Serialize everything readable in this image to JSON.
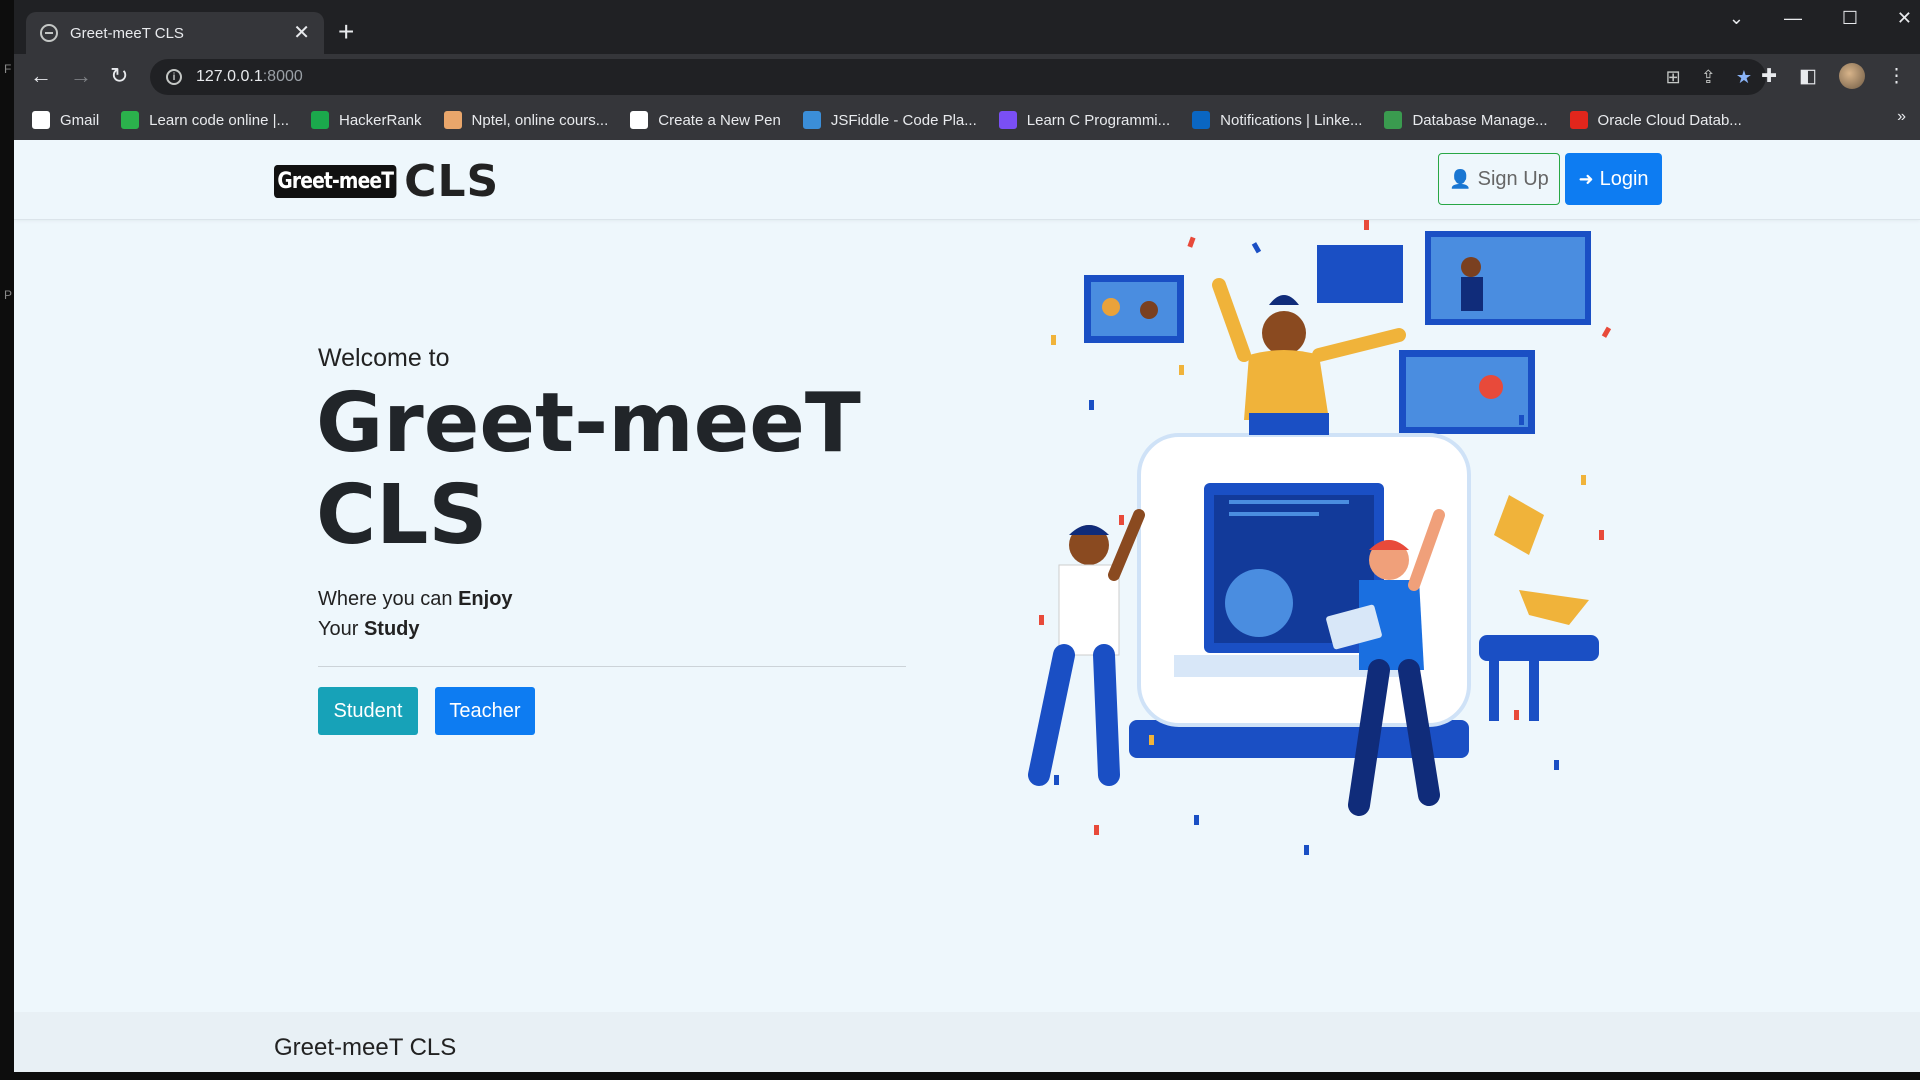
{
  "browser": {
    "tab_title": "Greet-meeT CLS",
    "tab_close": "✕",
    "new_tab": "+",
    "url_host": "127.0.0.1",
    "url_port": ":8000",
    "bookmarks": [
      {
        "label": "Gmail",
        "icon": "google-icon",
        "color": "#ffffff"
      },
      {
        "label": "Learn code online |...",
        "icon": "learncode-icon",
        "color": "#2bb24c"
      },
      {
        "label": "HackerRank",
        "icon": "hackerrank-icon",
        "color": "#1ba94c"
      },
      {
        "label": "Nptel, online cours...",
        "icon": "nptel-icon",
        "color": "#e9a66b"
      },
      {
        "label": "Create a New Pen",
        "icon": "codepen-icon",
        "color": "#ffffff"
      },
      {
        "label": "JSFiddle - Code Pla...",
        "icon": "jsfiddle-icon",
        "color": "#3b8ed8"
      },
      {
        "label": "Learn C Programmi...",
        "icon": "programiz-icon",
        "color": "#7a4ff5"
      },
      {
        "label": "Notifications | Linke...",
        "icon": "linkedin-icon",
        "color": "#0a66c2"
      },
      {
        "label": "Database Manage...",
        "icon": "database-icon",
        "color": "#3a9b4f"
      },
      {
        "label": "Oracle Cloud Datab...",
        "icon": "oracle-icon",
        "color": "#e1261c"
      }
    ],
    "bookmarks_more": "»"
  },
  "navbar": {
    "brand_box": "Greet-meeT",
    "brand_cls": "CLS",
    "signup_label": "Sign Up",
    "login_label": "Login"
  },
  "hero": {
    "welcome": "Welcome to",
    "title_line1": "Greet-meeT",
    "title_line2": "CLS",
    "tagline_1": "Where you can ",
    "tagline_1_bold": "Enjoy",
    "tagline_2": "Your ",
    "tagline_2_bold": "Study",
    "student_label": "Student",
    "teacher_label": "Teacher"
  },
  "footer": {
    "text": "Greet-meeT CLS"
  },
  "colors": {
    "accent": "#0d7cf2",
    "student": "#17a2b8",
    "signup_border": "#28a745",
    "page_bg": "#eef7fc"
  }
}
